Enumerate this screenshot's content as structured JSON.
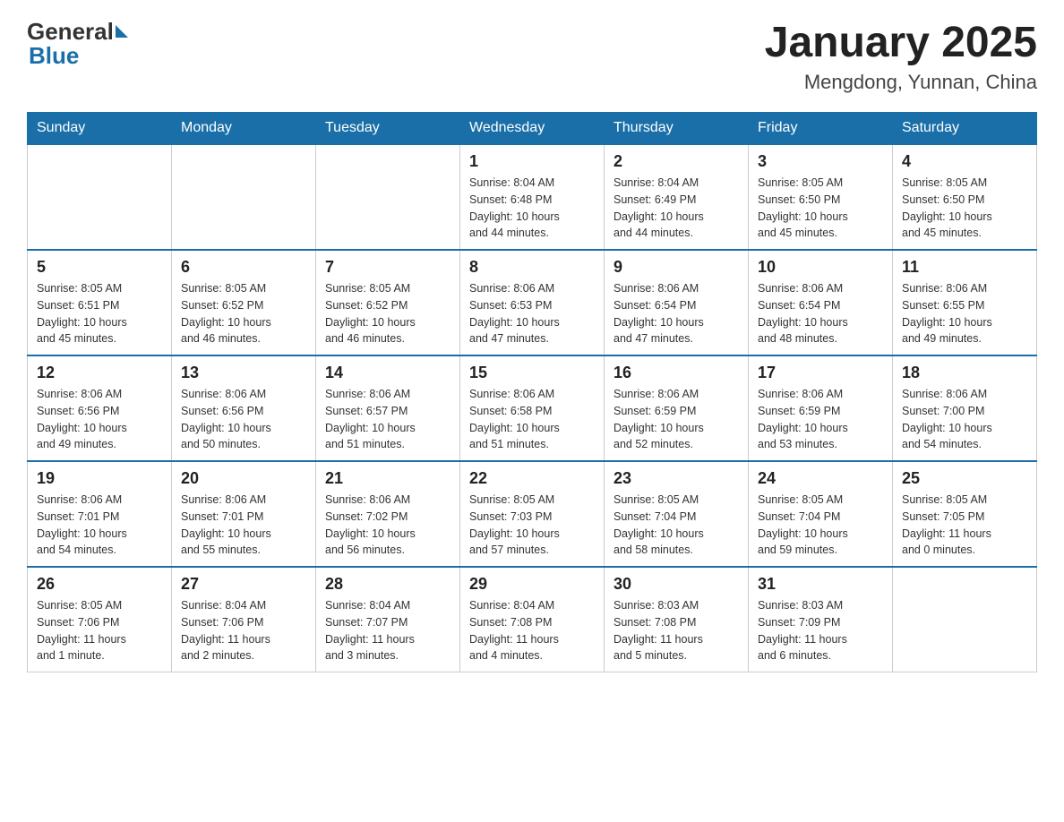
{
  "header": {
    "logo_general": "General",
    "logo_blue": "Blue",
    "title": "January 2025",
    "subtitle": "Mengdong, Yunnan, China"
  },
  "days_of_week": [
    "Sunday",
    "Monday",
    "Tuesday",
    "Wednesday",
    "Thursday",
    "Friday",
    "Saturday"
  ],
  "weeks": [
    [
      {
        "day": "",
        "info": ""
      },
      {
        "day": "",
        "info": ""
      },
      {
        "day": "",
        "info": ""
      },
      {
        "day": "1",
        "info": "Sunrise: 8:04 AM\nSunset: 6:48 PM\nDaylight: 10 hours\nand 44 minutes."
      },
      {
        "day": "2",
        "info": "Sunrise: 8:04 AM\nSunset: 6:49 PM\nDaylight: 10 hours\nand 44 minutes."
      },
      {
        "day": "3",
        "info": "Sunrise: 8:05 AM\nSunset: 6:50 PM\nDaylight: 10 hours\nand 45 minutes."
      },
      {
        "day": "4",
        "info": "Sunrise: 8:05 AM\nSunset: 6:50 PM\nDaylight: 10 hours\nand 45 minutes."
      }
    ],
    [
      {
        "day": "5",
        "info": "Sunrise: 8:05 AM\nSunset: 6:51 PM\nDaylight: 10 hours\nand 45 minutes."
      },
      {
        "day": "6",
        "info": "Sunrise: 8:05 AM\nSunset: 6:52 PM\nDaylight: 10 hours\nand 46 minutes."
      },
      {
        "day": "7",
        "info": "Sunrise: 8:05 AM\nSunset: 6:52 PM\nDaylight: 10 hours\nand 46 minutes."
      },
      {
        "day": "8",
        "info": "Sunrise: 8:06 AM\nSunset: 6:53 PM\nDaylight: 10 hours\nand 47 minutes."
      },
      {
        "day": "9",
        "info": "Sunrise: 8:06 AM\nSunset: 6:54 PM\nDaylight: 10 hours\nand 47 minutes."
      },
      {
        "day": "10",
        "info": "Sunrise: 8:06 AM\nSunset: 6:54 PM\nDaylight: 10 hours\nand 48 minutes."
      },
      {
        "day": "11",
        "info": "Sunrise: 8:06 AM\nSunset: 6:55 PM\nDaylight: 10 hours\nand 49 minutes."
      }
    ],
    [
      {
        "day": "12",
        "info": "Sunrise: 8:06 AM\nSunset: 6:56 PM\nDaylight: 10 hours\nand 49 minutes."
      },
      {
        "day": "13",
        "info": "Sunrise: 8:06 AM\nSunset: 6:56 PM\nDaylight: 10 hours\nand 50 minutes."
      },
      {
        "day": "14",
        "info": "Sunrise: 8:06 AM\nSunset: 6:57 PM\nDaylight: 10 hours\nand 51 minutes."
      },
      {
        "day": "15",
        "info": "Sunrise: 8:06 AM\nSunset: 6:58 PM\nDaylight: 10 hours\nand 51 minutes."
      },
      {
        "day": "16",
        "info": "Sunrise: 8:06 AM\nSunset: 6:59 PM\nDaylight: 10 hours\nand 52 minutes."
      },
      {
        "day": "17",
        "info": "Sunrise: 8:06 AM\nSunset: 6:59 PM\nDaylight: 10 hours\nand 53 minutes."
      },
      {
        "day": "18",
        "info": "Sunrise: 8:06 AM\nSunset: 7:00 PM\nDaylight: 10 hours\nand 54 minutes."
      }
    ],
    [
      {
        "day": "19",
        "info": "Sunrise: 8:06 AM\nSunset: 7:01 PM\nDaylight: 10 hours\nand 54 minutes."
      },
      {
        "day": "20",
        "info": "Sunrise: 8:06 AM\nSunset: 7:01 PM\nDaylight: 10 hours\nand 55 minutes."
      },
      {
        "day": "21",
        "info": "Sunrise: 8:06 AM\nSunset: 7:02 PM\nDaylight: 10 hours\nand 56 minutes."
      },
      {
        "day": "22",
        "info": "Sunrise: 8:05 AM\nSunset: 7:03 PM\nDaylight: 10 hours\nand 57 minutes."
      },
      {
        "day": "23",
        "info": "Sunrise: 8:05 AM\nSunset: 7:04 PM\nDaylight: 10 hours\nand 58 minutes."
      },
      {
        "day": "24",
        "info": "Sunrise: 8:05 AM\nSunset: 7:04 PM\nDaylight: 10 hours\nand 59 minutes."
      },
      {
        "day": "25",
        "info": "Sunrise: 8:05 AM\nSunset: 7:05 PM\nDaylight: 11 hours\nand 0 minutes."
      }
    ],
    [
      {
        "day": "26",
        "info": "Sunrise: 8:05 AM\nSunset: 7:06 PM\nDaylight: 11 hours\nand 1 minute."
      },
      {
        "day": "27",
        "info": "Sunrise: 8:04 AM\nSunset: 7:06 PM\nDaylight: 11 hours\nand 2 minutes."
      },
      {
        "day": "28",
        "info": "Sunrise: 8:04 AM\nSunset: 7:07 PM\nDaylight: 11 hours\nand 3 minutes."
      },
      {
        "day": "29",
        "info": "Sunrise: 8:04 AM\nSunset: 7:08 PM\nDaylight: 11 hours\nand 4 minutes."
      },
      {
        "day": "30",
        "info": "Sunrise: 8:03 AM\nSunset: 7:08 PM\nDaylight: 11 hours\nand 5 minutes."
      },
      {
        "day": "31",
        "info": "Sunrise: 8:03 AM\nSunset: 7:09 PM\nDaylight: 11 hours\nand 6 minutes."
      },
      {
        "day": "",
        "info": ""
      }
    ]
  ]
}
